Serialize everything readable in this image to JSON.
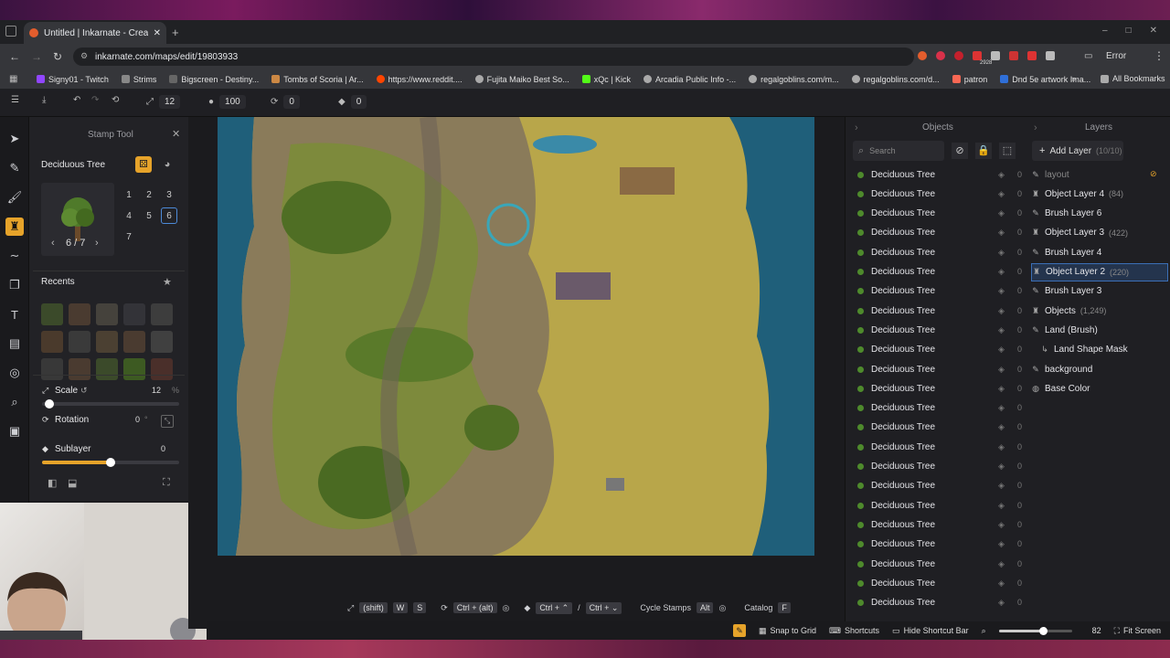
{
  "browser": {
    "tab_title": "Untitled | Inkarnate - Create Fa...",
    "url": "inkarnate.com/maps/edit/19803933",
    "profile_status": "Error",
    "bookmarks": [
      "Signy01 - Twitch",
      "Strims",
      "Bigscreen - Destiny...",
      "Tombs of Scoria | Ar...",
      "https://www.reddit....",
      "Fujita Maiko Best So...",
      "xQc | Kick",
      "Arcadia Public Info -...",
      "regalgoblins.com/m...",
      "regalgoblins.com/d...",
      "patron",
      "Dnd 5e artwork Ima...",
      "All Bookmarks"
    ],
    "badge_count": "2928"
  },
  "toolbar": {
    "scale_value": "12",
    "opacity_value": "100",
    "rotation_value": "0",
    "layer_value": "0"
  },
  "stamp_panel": {
    "title": "Stamp Tool",
    "stamp_name": "Deciduous Tree",
    "variants": [
      "1",
      "2",
      "3",
      "4",
      "5",
      "6",
      "7"
    ],
    "selected_variant": "6",
    "pager": "6 / 7",
    "recents_label": "Recents",
    "scale_label": "Scale",
    "scale_value": "12",
    "scale_unit": "%",
    "scale_level": 0.05,
    "rotation_label": "Rotation",
    "rotation_value": "0",
    "rotation_unit": "°",
    "sublayer_label": "Sublayer",
    "sublayer_value": "0",
    "sublayer_level": 0.5
  },
  "objects": {
    "header": "Objects",
    "search_placeholder": "Search",
    "items": [
      "Deciduous Tree",
      "Deciduous Tree",
      "Deciduous Tree",
      "Deciduous Tree",
      "Deciduous Tree",
      "Deciduous Tree",
      "Deciduous Tree",
      "Deciduous Tree",
      "Deciduous Tree",
      "Deciduous Tree",
      "Deciduous Tree",
      "Deciduous Tree",
      "Deciduous Tree",
      "Deciduous Tree",
      "Deciduous Tree",
      "Deciduous Tree",
      "Deciduous Tree",
      "Deciduous Tree",
      "Deciduous Tree",
      "Deciduous Tree",
      "Deciduous Tree",
      "Deciduous Tree",
      "Deciduous Tree"
    ],
    "item_count": "0"
  },
  "layers": {
    "header": "Layers",
    "add_label": "Add Layer",
    "add_count": "(10/10)",
    "items": [
      {
        "name": "layout",
        "sub": "",
        "icon": "brush"
      },
      {
        "name": "Object Layer 4",
        "sub": "(84)",
        "icon": "object"
      },
      {
        "name": "Brush Layer 6",
        "sub": "",
        "icon": "brush"
      },
      {
        "name": "Object Layer 3",
        "sub": "(422)",
        "icon": "object"
      },
      {
        "name": "Brush Layer 4",
        "sub": "",
        "icon": "brush"
      },
      {
        "name": "Object Layer 2",
        "sub": "(220)",
        "icon": "object"
      },
      {
        "name": "Brush Layer 3",
        "sub": "",
        "icon": "brush"
      },
      {
        "name": "Objects",
        "sub": "(1,249)",
        "icon": "object"
      },
      {
        "name": "Land (Brush)",
        "sub": "",
        "icon": "brush"
      },
      {
        "name": "Land Shape Mask",
        "sub": "",
        "icon": "mask"
      },
      {
        "name": "background",
        "sub": "",
        "icon": "brush"
      },
      {
        "name": "Base Color",
        "sub": "",
        "icon": "color"
      }
    ],
    "selected": "Object Layer 2"
  },
  "shortcuts": {
    "shift": "(shift)",
    "w": "W",
    "s": "S",
    "ctrl_alt": "Ctrl + (alt)",
    "ctrl_up": "Ctrl + ⌃",
    "ctrl_down": "Ctrl + ⌄",
    "cycle": "Cycle Stamps",
    "alt": "Alt",
    "catalog": "Catalog",
    "f": "F"
  },
  "status": {
    "snap": "Snap to Grid",
    "shortcuts": "Shortcuts",
    "hide": "Hide Shortcut Bar",
    "zoom": "82",
    "zoom_level": 0.6,
    "fit": "Fit Screen"
  },
  "colors": {
    "accent": "#e6a32a",
    "selection": "#3b6fb6",
    "ocean": "#1f5f7a",
    "land": "#b8a64a"
  }
}
